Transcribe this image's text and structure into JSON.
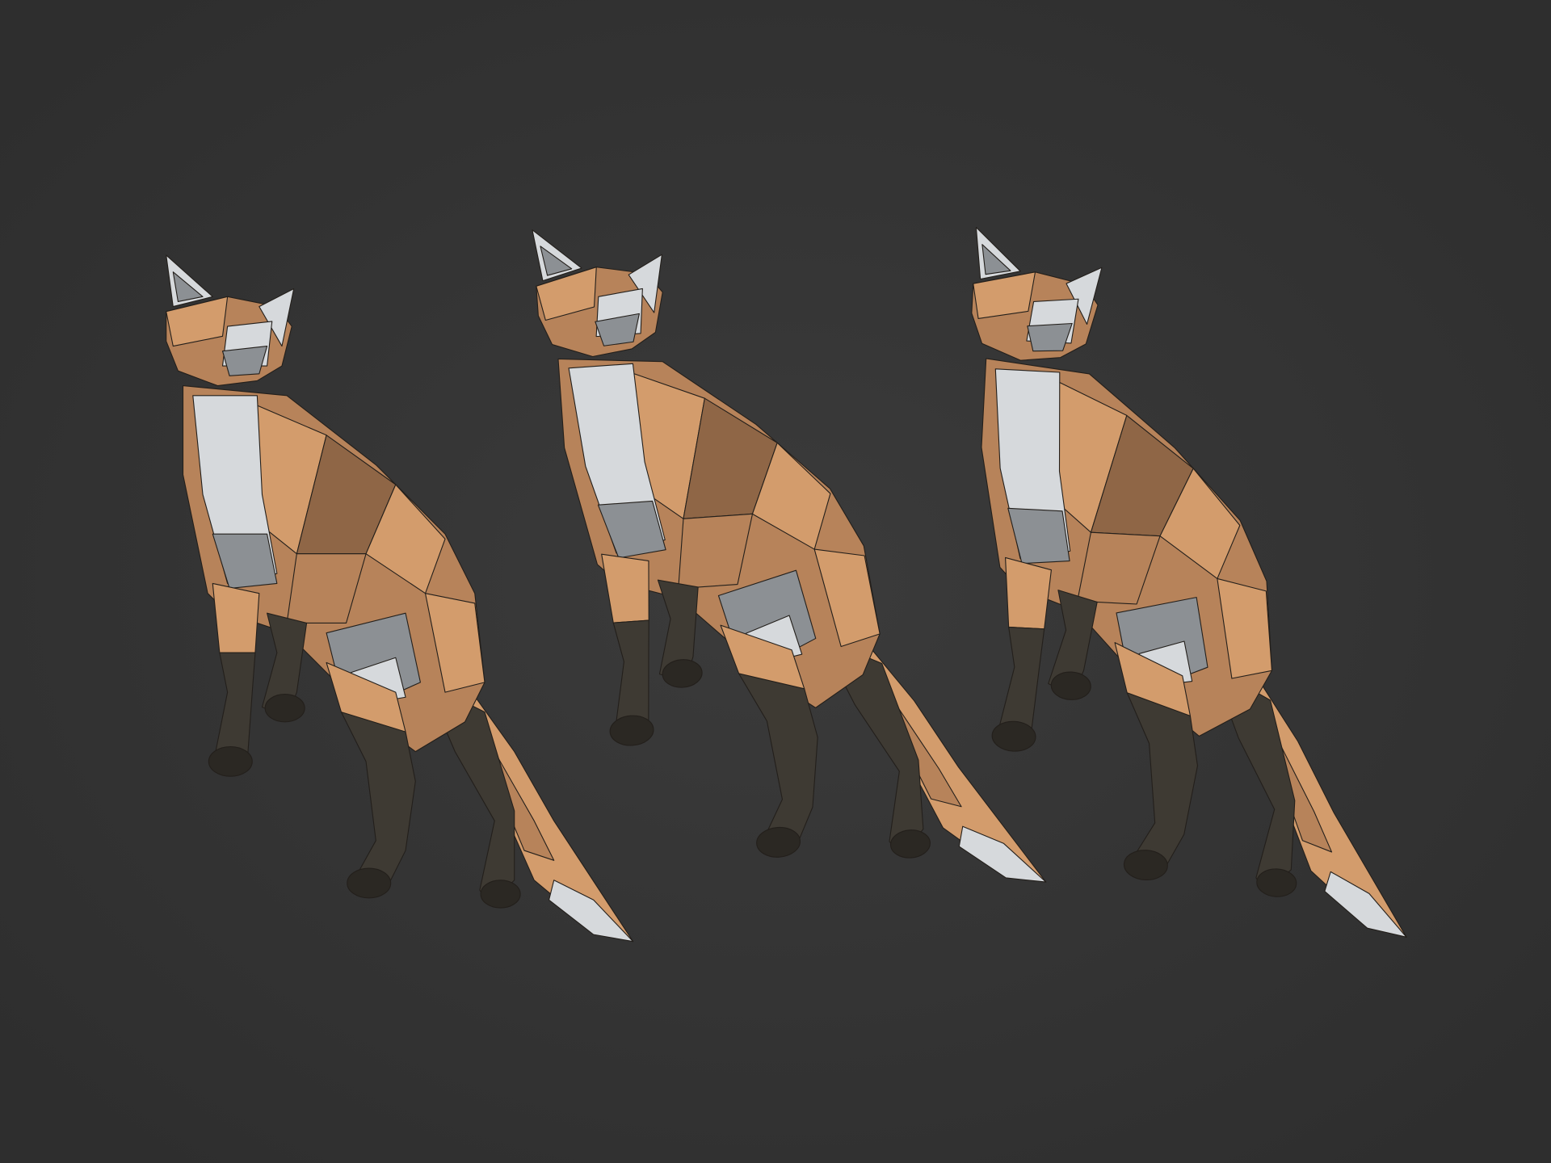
{
  "scene": {
    "fox_count": 3,
    "colors": {
      "background_center": "#3b3b3b",
      "background_edge": "#2e2e2e",
      "fur_light": "#d39c6c",
      "fur_mid": "#b7835a",
      "fur_dark": "#8f6646",
      "white_fur": "#d6d9dc",
      "grey_fur": "#8c9094",
      "leg_dark": "#3e3a33",
      "paw": "#2b2823"
    }
  }
}
